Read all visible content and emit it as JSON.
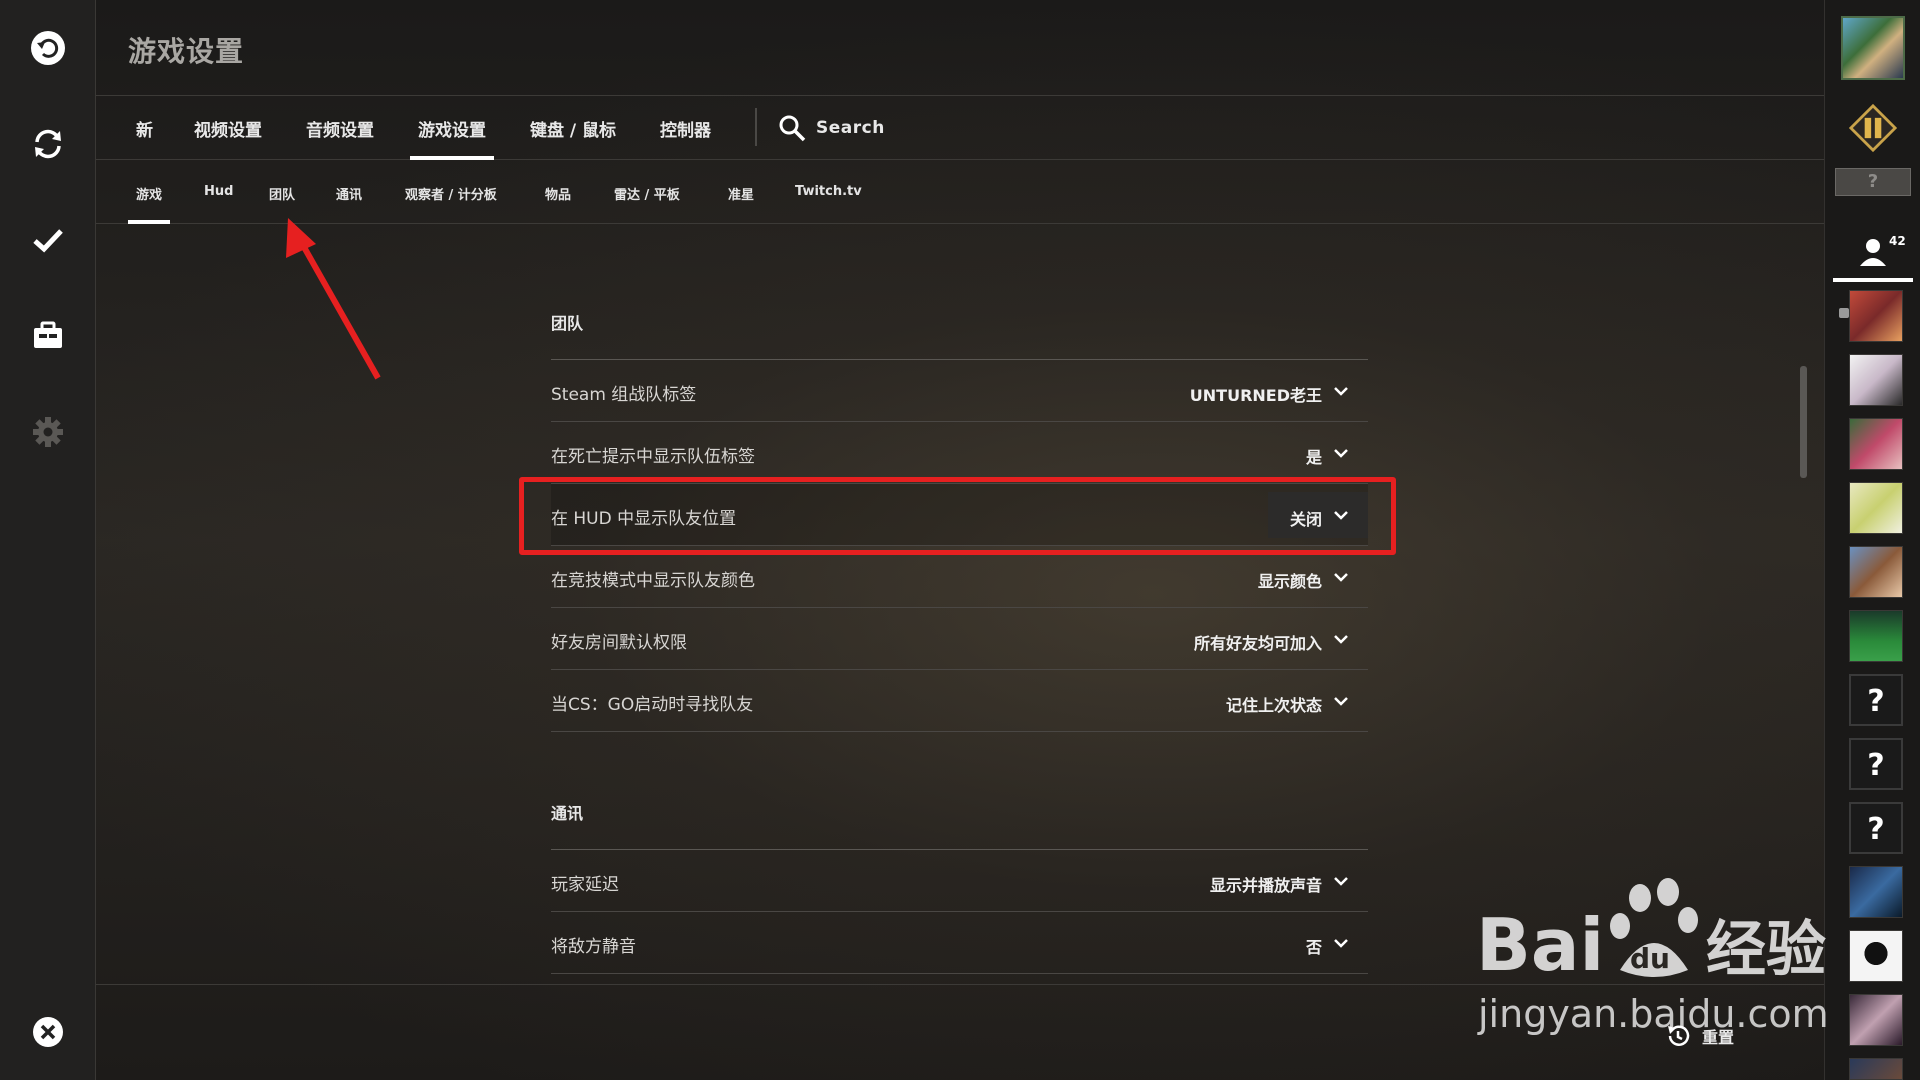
{
  "header": {
    "title": "游戏设置"
  },
  "main_tabs": [
    {
      "label": "新",
      "active": false
    },
    {
      "label": "视频设置",
      "active": false
    },
    {
      "label": "音频设置",
      "active": false
    },
    {
      "label": "游戏设置",
      "active": true
    },
    {
      "label": "键盘 / 鼠标",
      "active": false
    },
    {
      "label": "控制器",
      "active": false
    }
  ],
  "search": {
    "label": "Search",
    "icon": "search-icon"
  },
  "sub_tabs": [
    {
      "label": "游戏",
      "active": true
    },
    {
      "label": "Hud",
      "active": false
    },
    {
      "label": "团队",
      "active": false
    },
    {
      "label": "通讯",
      "active": false
    },
    {
      "label": "观察者 / 计分板",
      "active": false
    },
    {
      "label": "物品",
      "active": false
    },
    {
      "label": "雷达 / 平板",
      "active": false
    },
    {
      "label": "准星",
      "active": false
    },
    {
      "label": "Twitch.tv",
      "active": false
    }
  ],
  "sections": [
    {
      "title": "团队",
      "settings": [
        {
          "label": "Steam 组战队标签",
          "value": "UNTURNED老王"
        },
        {
          "label": "在死亡提示中显示队伍标签",
          "value": "是"
        },
        {
          "label": "在 HUD 中显示队友位置",
          "value": "关闭",
          "highlighted": true
        },
        {
          "label": "在竞技模式中显示队友颜色",
          "value": "显示颜色"
        },
        {
          "label": "好友房间默认权限",
          "value": "所有好友均可加入"
        },
        {
          "label": "当CS：GO启动时寻找队友",
          "value": "记住上次状态"
        }
      ]
    },
    {
      "title": "通讯",
      "settings": [
        {
          "label": "玩家延迟",
          "value": "显示并播放声音"
        },
        {
          "label": "将敌方静音",
          "value": "否"
        }
      ]
    }
  ],
  "footer": {
    "reset_label": "重置"
  },
  "left_rail": [
    "back-icon",
    "refresh-icon",
    "check-icon",
    "inventory-icon",
    "settings-gear-icon",
    "quit-icon"
  ],
  "right_rail": {
    "unknown_rank": "?",
    "friend_count": "42",
    "unknown_friend": "?"
  },
  "watermark": {
    "brand": "Bai经验",
    "url": "jingyan.baidu.com"
  },
  "colors": {
    "highlight_frame": "#e62020",
    "accent_white": "#ffffff",
    "background": "#1e1c1a"
  }
}
